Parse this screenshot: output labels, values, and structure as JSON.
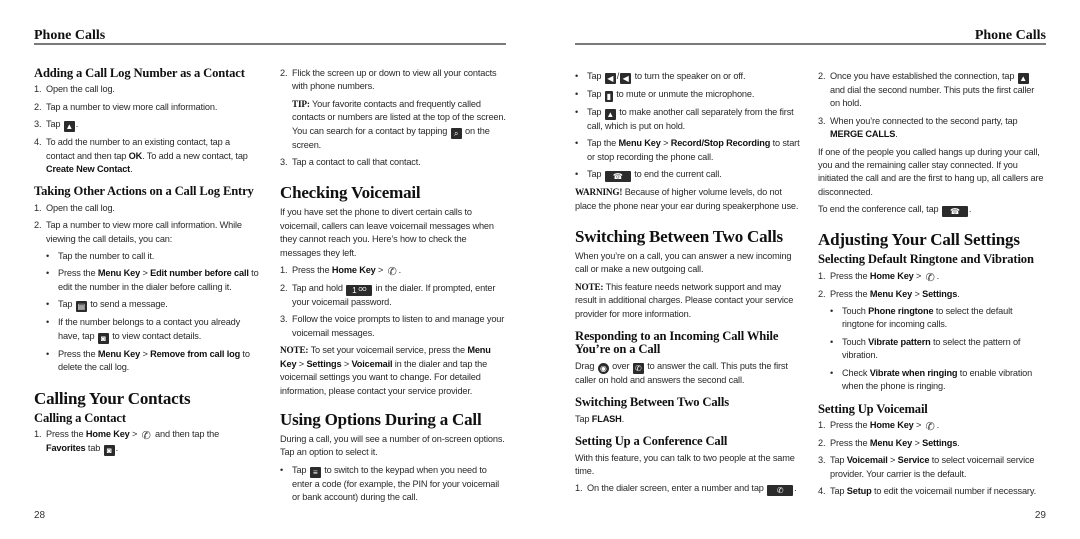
{
  "left_page": {
    "running_head": "Phone Calls",
    "page_number": "28",
    "col1": {
      "s1_title": "Adding a Call Log Number as a Contact",
      "s1_steps": [
        {
          "n": "1.",
          "text": "Open the call log."
        },
        {
          "n": "2.",
          "text": "Tap a number to view more call information."
        },
        {
          "n": "3.",
          "pre": "Tap",
          "icon": "add-contact-icon",
          "post": "."
        },
        {
          "n": "4.",
          "pre": "To add the number to an existing contact, tap a contact and then tap ",
          "b1": "OK",
          "mid": ". To add a new contact, tap ",
          "b2": "Create New Contact",
          "post": "."
        }
      ],
      "s2_title": "Taking Other Actions on a Call Log Entry",
      "s2_steps": [
        {
          "n": "1.",
          "text": "Open the call log."
        },
        {
          "n": "2.",
          "text": "Tap a number to view more call information. While viewing the call details, you can:"
        }
      ],
      "s2_bullets": [
        {
          "text": "Tap the number to call it."
        },
        {
          "pre": "Press the ",
          "b1": "Menu Key",
          "mid": " > ",
          "b2": "Edit number before call",
          "post": " to edit the number in the dialer before calling it."
        },
        {
          "pre": "Tap",
          "icon": "message-icon",
          "post": "to send a message."
        },
        {
          "pre": "If the number belongs to a contact you already have, tap",
          "icon": "contact-details-icon",
          "post": "to view contact details."
        },
        {
          "pre": "Press the ",
          "b1": "Menu Key",
          "mid": " > ",
          "b2": "Remove from call log",
          "post": " to delete the call log."
        }
      ],
      "s3_title": "Calling Your Contacts",
      "s4_title": "Calling a Contact",
      "s4_step1": {
        "n": "1.",
        "pre": "Press the ",
        "b1": "Home Key",
        "mid": " > ",
        "icon": "phone-icon",
        "post": " and then tap the ",
        "b2": "Favorites",
        "post2": " tab",
        "icon2": "favorites-icon",
        "end": "."
      }
    },
    "col2": {
      "step2": {
        "n": "2.",
        "text": "Flick the screen up or down to view all your contacts with phone numbers."
      },
      "tip_label": "TIP:",
      "tip_text": "Your favorite contacts and frequently called contacts or numbers are listed at the top of the screen.  You can search for a contact by tapping",
      "tip_icon": "search-icon",
      "tip_end": "on the screen.",
      "step3": {
        "n": "3.",
        "text": "Tap a contact to call that contact."
      },
      "vm_title": "Checking Voicemail",
      "vm_intro": "If you have set the phone to divert certain calls to voicemail, callers can leave voicemail messages when they cannot reach you. Here’s how to check the messages they left.",
      "vm_steps": [
        {
          "n": "1.",
          "pre": "Press the ",
          "b1": "Home Key",
          "mid": " > ",
          "icon": "phone-icon",
          "post": "."
        },
        {
          "n": "2.",
          "pre": "Tap and hold",
          "icon": "voicemail-key-1-icon",
          "icon_text": "1 ᴼᴼ",
          "post": "in the dialer. If prompted, enter your voicemail password."
        },
        {
          "n": "3.",
          "text": "Follow the voice prompts to listen to and manage your voicemail messages."
        }
      ],
      "note_label": "NOTE:",
      "note_pre": "To set your voicemail service, press the ",
      "note_b1": "Menu Key",
      "note_sep1": " > ",
      "note_b2": "Settings",
      "note_sep2": " > ",
      "note_b3": "Voicemail",
      "note_post": " in the dialer and tap the voicemail settings you want to change. For detailed information, please contact your service provider.",
      "opt_title": "Using Options During a Call",
      "opt_intro": "During a call, you will see a number of on-screen options. Tap an option to select it.",
      "opt_bullet": {
        "pre": "Tap",
        "icon": "keypad-icon",
        "post": "to switch to the keypad when you need to enter a code (for example, the PIN for your voicemail or bank account) during the call."
      }
    }
  },
  "right_page": {
    "running_head": "Phone Calls",
    "page_number": "29",
    "col3": {
      "bullets": [
        {
          "pre": "Tap",
          "icon": "speaker-on-icon",
          "sep": "/",
          "icon2": "speaker-off-icon",
          "post": "to turn the speaker on or off."
        },
        {
          "pre": "Tap",
          "icon": "mute-icon",
          "post": "to mute or unmute the microphone."
        },
        {
          "pre": "Tap",
          "icon": "add-call-icon",
          "post": "to make another call separately from the first call, which is put on hold."
        },
        {
          "pre": "Tap the ",
          "b1": "Menu Key",
          "mid": " > ",
          "b2": "Record/Stop Recording",
          "post": " to start or stop recording the phone call."
        },
        {
          "pre": "Tap",
          "icon": "end-call-icon",
          "post": "to end the current call."
        }
      ],
      "warning_label": "WARNING!",
      "warning_text": "Because of higher volume levels, do not place the phone near your ear during speakerphone use.",
      "switch_title": "Switching Between Two Calls",
      "switch_intro": "When you’re on a call, you can answer a new incoming call or make a new outgoing call.",
      "note_label": "NOTE:",
      "note_text": "This feature needs network support and may result in additional charges. Please contact your service provider for more information.",
      "respond_title": "Responding to an Incoming Call While You’re on a Call",
      "respond_pre": "Drag",
      "respond_icon": "answer-handle-icon",
      "respond_mid": "over",
      "respond_icon2": "answer-target-icon",
      "respond_post": "to answer the call. This puts the first caller on hold and answers the second call.",
      "switch2_title": "Switching Between Two Calls",
      "switch2_pre": "Tap ",
      "switch2_b": "FLASH",
      "switch2_post": ".",
      "conf_title": "Setting Up a Conference Call",
      "conf_intro": "With this feature, you can talk to two people at the same time.",
      "conf_step1": {
        "n": "1.",
        "pre": "On the dialer screen, enter a number and tap",
        "icon": "dial-icon",
        "post": "."
      }
    },
    "col4": {
      "conf_steps": [
        {
          "n": "2.",
          "pre": "Once you have established the connection, tap",
          "icon": "add-call-icon",
          "post": "and dial the second number. This puts the first caller on hold."
        },
        {
          "n": "3.",
          "pre": "When you’re connected to the second party, tap ",
          "b1": "MERGE CALLS",
          "post": "."
        }
      ],
      "conf_para": "If one of the people you called hangs up during your call, you and the remaining caller stay connected. If you initiated the call and are the first to hang up, all callers are disconnected.",
      "conf_end_pre": "To end the conference call, tap",
      "conf_end_icon": "end-call-icon",
      "conf_end_post": ".",
      "adjust_title": "Adjusting Your Call Settings",
      "ring_title": "Selecting Default Ringtone and Vibration",
      "ring_steps": [
        {
          "n": "1.",
          "pre": "Press the ",
          "b1": "Home Key",
          "mid": " > ",
          "icon": "phone-icon",
          "post": "."
        },
        {
          "n": "2.",
          "pre": "Press the ",
          "b1": "Menu Key",
          "mid": " > ",
          "b2": "Settings",
          "post": "."
        }
      ],
      "ring_bullets": [
        {
          "pre": "Touch ",
          "b1": "Phone ringtone",
          "post": " to select the default ringtone for incoming calls."
        },
        {
          "pre": "Touch ",
          "b1": "Vibrate pattern",
          "post": " to select the pattern of vibration."
        },
        {
          "pre": "Check ",
          "b1": "Vibrate when ringing",
          "post": " to enable vibration when the phone is ringing."
        }
      ],
      "vm_title": "Setting Up Voicemail",
      "vm_steps": [
        {
          "n": "1.",
          "pre": "Press the ",
          "b1": "Home Key",
          "mid": " > ",
          "icon": "phone-icon",
          "post": "."
        },
        {
          "n": "2.",
          "pre": "Press the ",
          "b1": "Menu Key",
          "mid": " > ",
          "b2": "Settings",
          "post": "."
        },
        {
          "n": "3.",
          "pre": "Tap ",
          "b1": "Voicemail",
          "mid": " > ",
          "b2": "Service",
          "post": " to select voicemail service provider. Your carrier is the default."
        },
        {
          "n": "4.",
          "pre": "Tap ",
          "b1": "Setup",
          "post": " to edit the voicemail number if necessary."
        }
      ]
    }
  },
  "icons": {
    "phone": "📞",
    "bullet": "•",
    "search": "⌕",
    "speaker": "◀",
    "mute": "▮",
    "add_contact": "▲",
    "end_call": "☎",
    "keypad": "≡",
    "message": "▤",
    "contact": "◙"
  }
}
